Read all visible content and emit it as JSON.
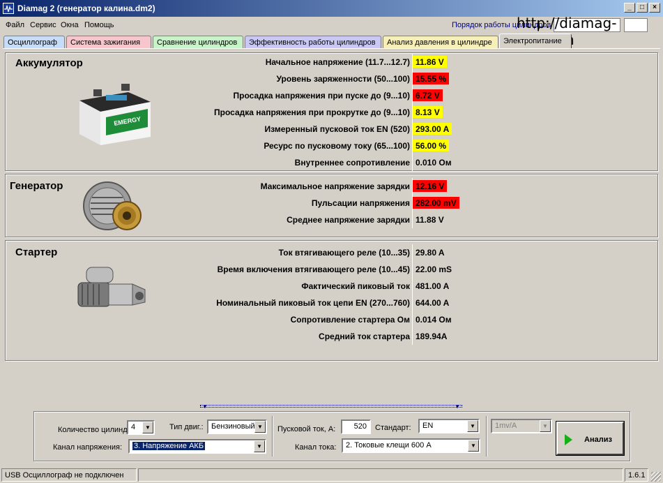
{
  "window": {
    "title": "Diamag 2 (генератор калина.dm2)",
    "buttons": {
      "minimize": "_",
      "maximize": "□",
      "close": "×"
    }
  },
  "menu": [
    "Файл",
    "Сервис",
    "Окна",
    "Помощь"
  ],
  "cylinder_order_label": "Порядок работы цилиндров",
  "watermark": "http://diamag-osc.com",
  "tabs": [
    {
      "label": "Осциллограф",
      "color": "#c6dcf7"
    },
    {
      "label": "Система зажигания",
      "color": "#f7c6cc"
    },
    {
      "label": "Сравнение цилиндров",
      "color": "#c8f2c8"
    },
    {
      "label": "Эффективность работы цилиндров",
      "color": "#c9c8f5"
    },
    {
      "label": "Анализ давления в цилиндре",
      "color": "#f7efb8"
    },
    {
      "label": "Электропитание",
      "color": "#d4d0c8",
      "active": true
    }
  ],
  "battery": {
    "title": "Аккумулятор",
    "image_label": "EMERGY",
    "rows": [
      {
        "label": "Начальное напряжение (11.7...12.7)",
        "value": "11.86 V",
        "status": "yellow"
      },
      {
        "label": "Уровень заряженности (50...100)",
        "value": "15.55 %",
        "status": "red"
      },
      {
        "label": "Просадка напряжения при пуске до (9...10)",
        "value": "6.72 V",
        "status": "red"
      },
      {
        "label": "Просадка напряжения при прокрутке до  (9...10)",
        "value": "8.13 V",
        "status": "yellow"
      },
      {
        "label": "Измеренный пусковой ток  EN (520)",
        "value": "293.00 A",
        "status": "yellow"
      },
      {
        "label": "Ресурс по пусковому току (65...100)",
        "value": "56.00 %",
        "status": "yellow"
      },
      {
        "label": "Внутреннее сопротивление",
        "value": "0.010 Ом",
        "status": "none"
      }
    ]
  },
  "generator": {
    "title": "Генератор",
    "rows": [
      {
        "label": "Максимальное напряжение зарядки",
        "value": "12.16 V",
        "status": "red"
      },
      {
        "label": "Пульсации напряжения",
        "value": "282.00 mV",
        "status": "red"
      },
      {
        "label": "Среднее напряжение зарядки",
        "value": "11.88 V",
        "status": "none"
      }
    ]
  },
  "starter": {
    "title": "Стартер",
    "rows": [
      {
        "label": "Ток втягивающего реле (10...35)",
        "value": "29.80 A",
        "status": "none"
      },
      {
        "label": "Время включения втягивающего реле (10...45)",
        "value": "22.00 mS",
        "status": "none"
      },
      {
        "label": "Фактический пиковый ток",
        "value": "481.00 A",
        "status": "none"
      },
      {
        "label": "Номинальный пиковый ток цепи EN (270...760)",
        "value": "644.00 A",
        "status": "none"
      },
      {
        "label": "Сопротивление стартера Ом",
        "value": "0.014 Ом",
        "status": "none"
      },
      {
        "label": "Средний ток стартера",
        "value": "189.94A",
        "status": "none"
      }
    ]
  },
  "controls": {
    "cylinders_label": "Количество цилиндров:",
    "cylinders_value": "4",
    "engine_type_label": "Тип двиг.:",
    "engine_type_value": "Бензиновый",
    "voltage_channel_label": "Канал напряжения:",
    "voltage_channel_value": "3. Напряжение АКБ",
    "start_current_label": "Пусковой ток, А:",
    "start_current_value": "520",
    "standard_label": "Стандарт:",
    "standard_value": "EN",
    "current_channel_label": "Канал тока:",
    "current_channel_value": "2.  Токовые клещи 600 А",
    "sensitivity_value": "1mv/A",
    "analyze_label": "Анализ"
  },
  "status": {
    "message": "USB Осциллограф не подключен",
    "version": "1.6.1"
  }
}
